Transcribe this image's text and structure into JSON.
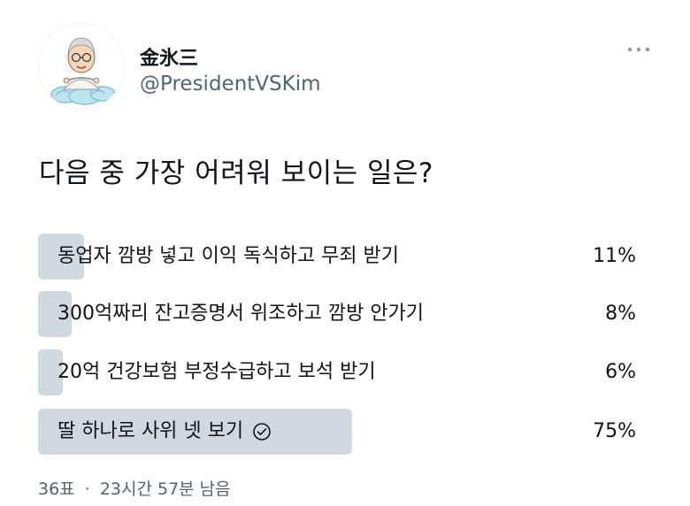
{
  "author": {
    "display_name": "金氷三",
    "handle": "@PresidentVSKim",
    "avatar": "cartoon-caricature-on-cloud"
  },
  "menu": {
    "icon": "more-dots-icon"
  },
  "tweet": {
    "text": "다음 중 가장 어려워 보이는 일은?"
  },
  "poll": {
    "options": [
      {
        "label": "동업자 깜방 넣고 이익 독식하고 무죄 받기",
        "percent_text": "11%",
        "percent": 11,
        "selected": false
      },
      {
        "label": "300억짜리 잔고증명서 위조하고 깜방 안가기",
        "percent_text": "8%",
        "percent": 8,
        "selected": false
      },
      {
        "label": "20억 건강보험 부정수급하고 보석 받기",
        "percent_text": "6%",
        "percent": 6,
        "selected": false
      },
      {
        "label": "딸 하나로 사위 넷 보기",
        "percent_text": "75%",
        "percent": 75,
        "selected": true
      }
    ],
    "votes": "36표",
    "separator": "·",
    "time_left": "23시간 57분 남음"
  },
  "colors": {
    "bar": "#cfd9de",
    "text": "#0f1419",
    "secondary": "#536471"
  }
}
